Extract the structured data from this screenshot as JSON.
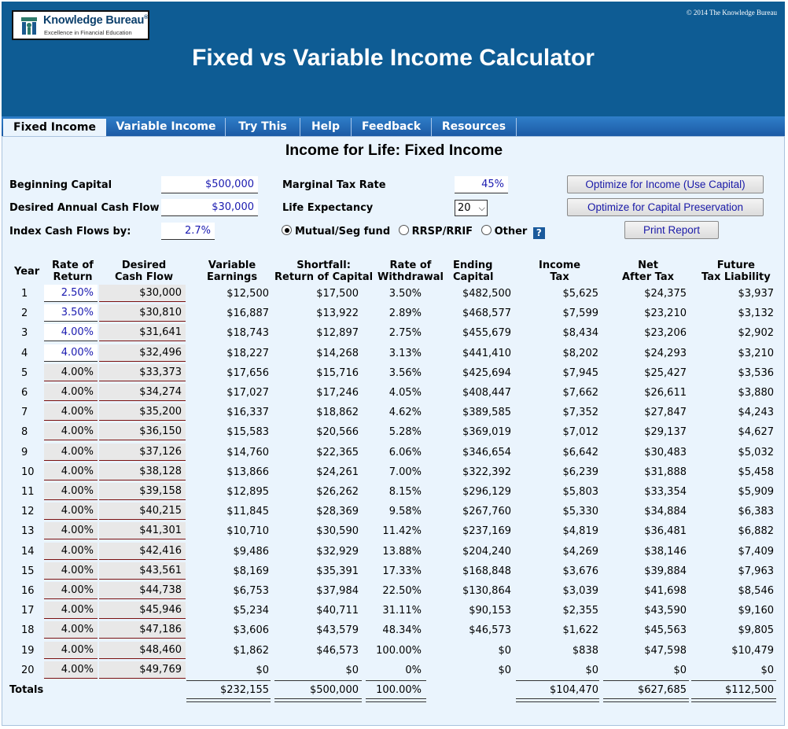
{
  "header": {
    "logo_name": "Knowledge Bureau",
    "logo_tagline": "Excellence in Financial Education",
    "copyright": "© 2014 The Knowledge Bureau",
    "title": "Fixed vs Variable Income Calculator"
  },
  "tabs": [
    "Fixed Income",
    "Variable Income",
    "Try This",
    "Help",
    "Feedback",
    "Resources"
  ],
  "page_title": "Income for Life: Fixed Income",
  "inputs": {
    "beginning_capital_label": "Beginning Capital",
    "beginning_capital": "$500,000",
    "desired_cash_flow_label": "Desired Annual Cash Flow",
    "desired_cash_flow": "$30,000",
    "index_label": "Index Cash Flows by:",
    "index_value": "2.7%",
    "tax_rate_label": "Marginal Tax Rate",
    "tax_rate": "45%",
    "life_expectancy_label": "Life Expectancy",
    "life_expectancy": "20",
    "radio_options": [
      "Mutual/Seg fund",
      "RRSP/RRIF",
      "Other"
    ],
    "radio_selected": "Mutual/Seg fund",
    "help_icon": "?"
  },
  "buttons": {
    "optimize_income": "Optimize for Income (Use Capital)",
    "optimize_capital": "Optimize for Capital Preservation",
    "print": "Print Report"
  },
  "table": {
    "headers": [
      [
        "Year",
        ""
      ],
      [
        "Rate of",
        "Return"
      ],
      [
        "Desired",
        "Cash Flow"
      ],
      [
        "Variable",
        "Earnings"
      ],
      [
        "Shortfall:",
        "Return of Capital"
      ],
      [
        "Rate of",
        "Withdrawal"
      ],
      [
        "Ending",
        "Capital"
      ],
      [
        "Income",
        "Tax"
      ],
      [
        "Net",
        "After Tax"
      ],
      [
        "Future",
        "Tax Liability"
      ]
    ],
    "rows": [
      [
        "1",
        "2.50%",
        "$30,000",
        "$12,500",
        "$17,500",
        "3.50%",
        "$482,500",
        "$5,625",
        "$24,375",
        "$3,937"
      ],
      [
        "2",
        "3.50%",
        "$30,810",
        "$16,887",
        "$13,922",
        "2.89%",
        "$468,577",
        "$7,599",
        "$23,210",
        "$3,132"
      ],
      [
        "3",
        "4.00%",
        "$31,641",
        "$18,743",
        "$12,897",
        "2.75%",
        "$455,679",
        "$8,434",
        "$23,206",
        "$2,902"
      ],
      [
        "4",
        "4.00%",
        "$32,496",
        "$18,227",
        "$14,268",
        "3.13%",
        "$441,410",
        "$8,202",
        "$24,293",
        "$3,210"
      ],
      [
        "5",
        "4.00%",
        "$33,373",
        "$17,656",
        "$15,716",
        "3.56%",
        "$425,694",
        "$7,945",
        "$25,427",
        "$3,536"
      ],
      [
        "6",
        "4.00%",
        "$34,274",
        "$17,027",
        "$17,246",
        "4.05%",
        "$408,447",
        "$7,662",
        "$26,611",
        "$3,880"
      ],
      [
        "7",
        "4.00%",
        "$35,200",
        "$16,337",
        "$18,862",
        "4.62%",
        "$389,585",
        "$7,352",
        "$27,847",
        "$4,243"
      ],
      [
        "8",
        "4.00%",
        "$36,150",
        "$15,583",
        "$20,566",
        "5.28%",
        "$369,019",
        "$7,012",
        "$29,137",
        "$4,627"
      ],
      [
        "9",
        "4.00%",
        "$37,126",
        "$14,760",
        "$22,365",
        "6.06%",
        "$346,654",
        "$6,642",
        "$30,483",
        "$5,032"
      ],
      [
        "10",
        "4.00%",
        "$38,128",
        "$13,866",
        "$24,261",
        "7.00%",
        "$322,392",
        "$6,239",
        "$31,888",
        "$5,458"
      ],
      [
        "11",
        "4.00%",
        "$39,158",
        "$12,895",
        "$26,262",
        "8.15%",
        "$296,129",
        "$5,803",
        "$33,354",
        "$5,909"
      ],
      [
        "12",
        "4.00%",
        "$40,215",
        "$11,845",
        "$28,369",
        "9.58%",
        "$267,760",
        "$5,330",
        "$34,884",
        "$6,383"
      ],
      [
        "13",
        "4.00%",
        "$41,301",
        "$10,710",
        "$30,590",
        "11.42%",
        "$237,169",
        "$4,819",
        "$36,481",
        "$6,882"
      ],
      [
        "14",
        "4.00%",
        "$42,416",
        "$9,486",
        "$32,929",
        "13.88%",
        "$204,240",
        "$4,269",
        "$38,146",
        "$7,409"
      ],
      [
        "15",
        "4.00%",
        "$43,561",
        "$8,169",
        "$35,391",
        "17.33%",
        "$168,848",
        "$3,676",
        "$39,884",
        "$7,963"
      ],
      [
        "16",
        "4.00%",
        "$44,738",
        "$6,753",
        "$37,984",
        "22.50%",
        "$130,864",
        "$3,039",
        "$41,698",
        "$8,546"
      ],
      [
        "17",
        "4.00%",
        "$45,946",
        "$5,234",
        "$40,711",
        "31.11%",
        "$90,153",
        "$2,355",
        "$43,590",
        "$9,160"
      ],
      [
        "18",
        "4.00%",
        "$47,186",
        "$3,606",
        "$43,579",
        "48.34%",
        "$46,573",
        "$1,622",
        "$45,563",
        "$9,805"
      ],
      [
        "19",
        "4.00%",
        "$48,460",
        "$1,862",
        "$46,573",
        "100.00%",
        "$0",
        "$838",
        "$47,598",
        "$10,479"
      ],
      [
        "20",
        "4.00%",
        "$49,769",
        "$0",
        "$0",
        "0%",
        "$0",
        "$0",
        "$0",
        "$0"
      ]
    ],
    "editable_rate_rows": 4,
    "totals_label": "Totals",
    "totals": {
      "variable_earnings": "$232,155",
      "return_of_capital": "$500,000",
      "withdrawal": "100.00%",
      "income_tax": "$104,470",
      "net_after_tax": "$627,685",
      "future_tax": "$112,500"
    }
  }
}
